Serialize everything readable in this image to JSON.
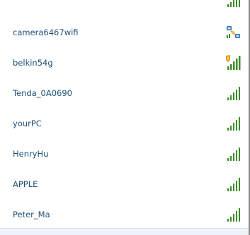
{
  "networks": [
    {
      "name": "camera6467wifi",
      "icon": "unknown-network-icon",
      "secured": false,
      "bars": 0
    },
    {
      "name": "belkin54g",
      "icon": "shield-signal-icon",
      "secured": true,
      "bars": 5
    },
    {
      "name": "Tenda_0A0690",
      "icon": "signal-strength-icon",
      "secured": false,
      "bars": 5
    },
    {
      "name": "yourPC",
      "icon": "signal-strength-icon",
      "secured": false,
      "bars": 5
    },
    {
      "name": "HenryHu",
      "icon": "signal-strength-icon",
      "secured": false,
      "bars": 5
    },
    {
      "name": "APPLE",
      "icon": "signal-strength-icon",
      "secured": false,
      "bars": 5
    },
    {
      "name": "Peter_Ma",
      "icon": "signal-strength-icon",
      "secured": false,
      "bars": 5
    }
  ],
  "colors": {
    "text": "#1c4f7a",
    "signal_green": "#3d8c2a",
    "shield_orange": "#e08a1a",
    "unknown_blue": "#2f73b8"
  }
}
